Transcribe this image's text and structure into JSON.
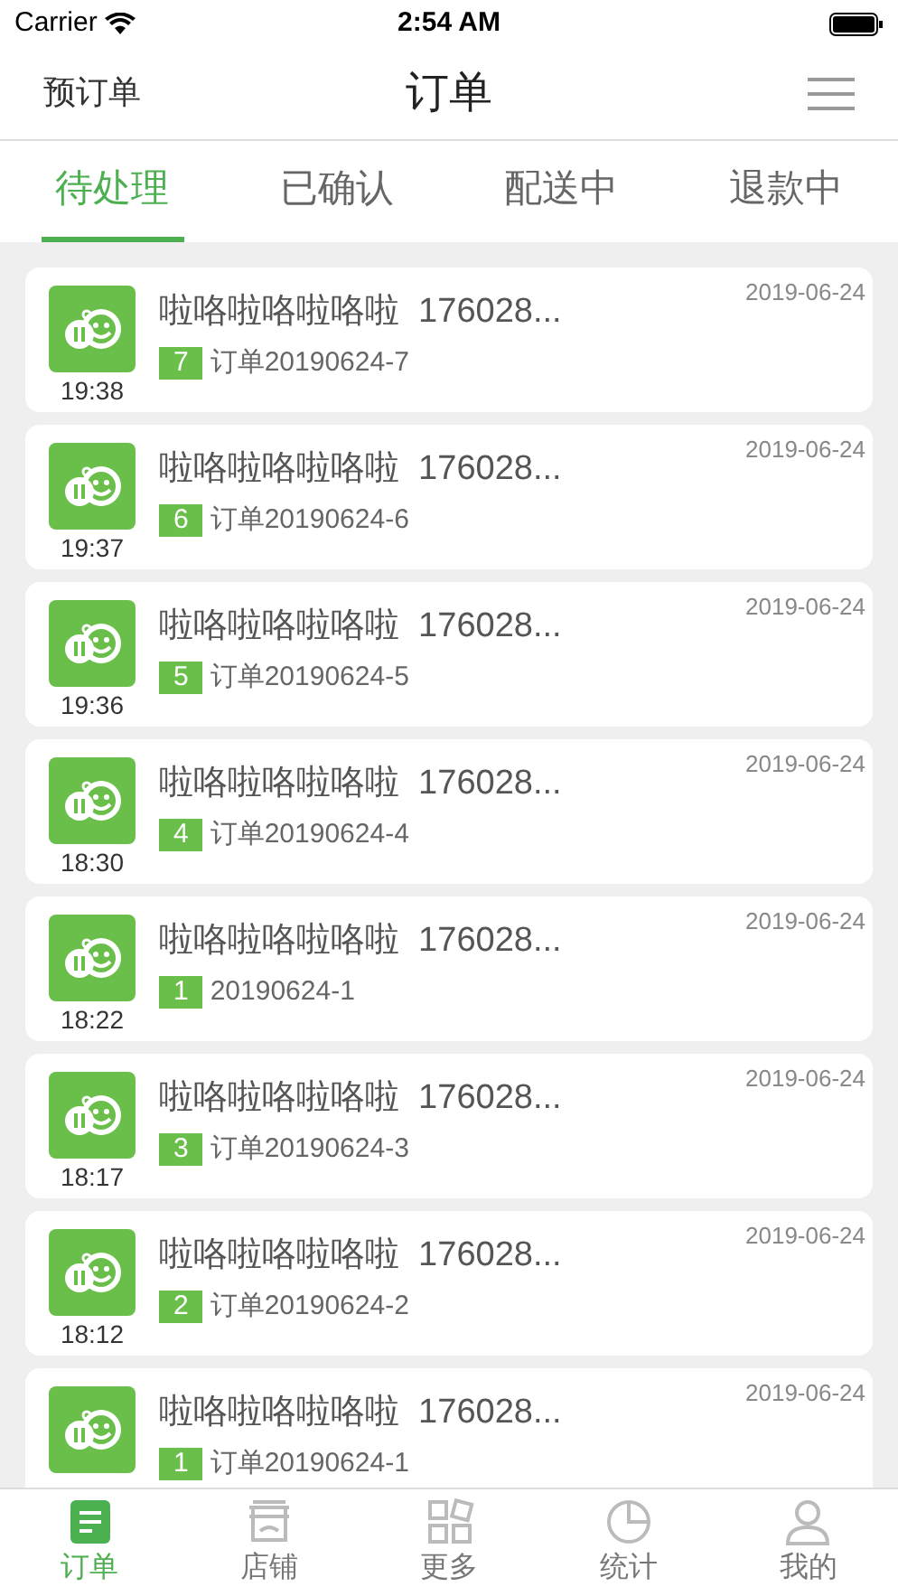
{
  "status_bar": {
    "carrier": "Carrier",
    "time": "2:54 AM"
  },
  "nav": {
    "left": "预订单",
    "title": "订单"
  },
  "tabs": [
    {
      "label": "待处理",
      "selected": true
    },
    {
      "label": "已确认",
      "selected": false
    },
    {
      "label": "配送中",
      "selected": false
    },
    {
      "label": "退款中",
      "selected": false
    }
  ],
  "orders": [
    {
      "time": "19:38",
      "title": "啦咯啦咯啦咯啦  176028...",
      "number": "7",
      "order": "订单20190624-7",
      "date": "2019-06-24"
    },
    {
      "time": "19:37",
      "title": "啦咯啦咯啦咯啦  176028...",
      "number": "6",
      "order": "订单20190624-6",
      "date": "2019-06-24"
    },
    {
      "time": "19:36",
      "title": "啦咯啦咯啦咯啦  176028...",
      "number": "5",
      "order": "订单20190624-5",
      "date": "2019-06-24"
    },
    {
      "time": "18:30",
      "title": "啦咯啦咯啦咯啦  176028...",
      "number": "4",
      "order": "订单20190624-4",
      "date": "2019-06-24"
    },
    {
      "time": "18:22",
      "title": "啦咯啦咯啦咯啦  176028...",
      "number": "1",
      "order": "20190624-1",
      "date": "2019-06-24"
    },
    {
      "time": "18:17",
      "title": "啦咯啦咯啦咯啦  176028...",
      "number": "3",
      "order": "订单20190624-3",
      "date": "2019-06-24"
    },
    {
      "time": "18:12",
      "title": "啦咯啦咯啦咯啦  176028...",
      "number": "2",
      "order": "订单20190624-2",
      "date": "2019-06-24"
    },
    {
      "title": "啦咯啦咯啦咯啦  176028...",
      "number": "1",
      "order": "订单20190624-1",
      "date": "2019-06-24"
    }
  ],
  "tab_bar": [
    {
      "kind": "orders",
      "label": "订单",
      "selected": true
    },
    {
      "kind": "shop",
      "label": "店铺",
      "selected": false
    },
    {
      "kind": "more",
      "label": "更多",
      "selected": false
    },
    {
      "kind": "stats",
      "label": "统计",
      "selected": false
    },
    {
      "kind": "me",
      "label": "我的",
      "selected": false
    }
  ]
}
